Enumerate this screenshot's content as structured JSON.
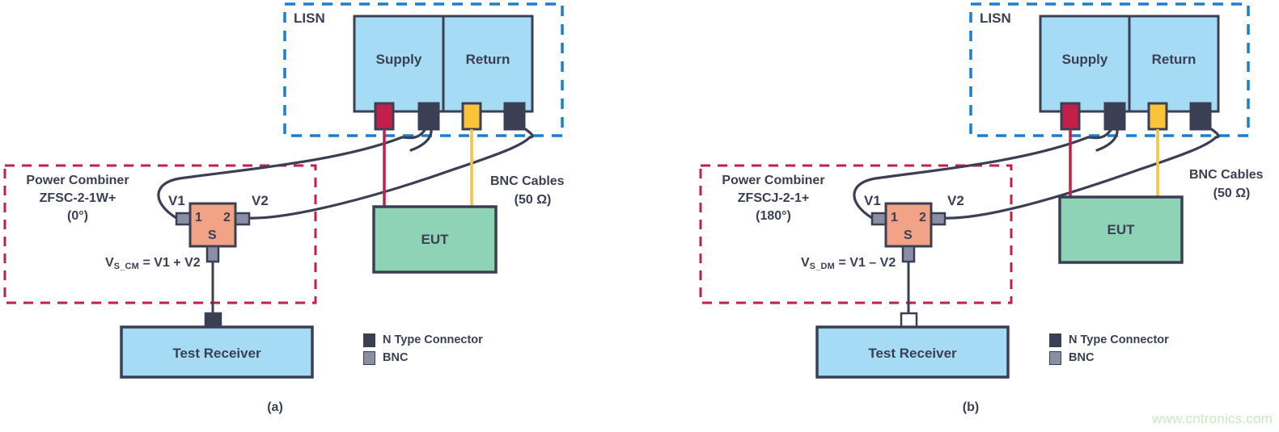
{
  "figure": {
    "watermark": "www.cntronics.com",
    "colors": {
      "stroke_dark": "#3b3f54",
      "box_blue": "#a5dbf5",
      "box_green": "#8ed3b6",
      "box_orange": "#f2a285",
      "dash_blue": "#1a7fd4",
      "dash_red": "#c2204a",
      "conn_red": "#c2204a",
      "conn_yellow": "#fac338",
      "conn_n": "#3b3f54",
      "conn_bnc": "#8a8fa3",
      "watermark_green": "#cfe6c4"
    }
  },
  "legend": {
    "items": [
      {
        "label": "N Type Connector",
        "swatch": "n-type"
      },
      {
        "label": "BNC",
        "swatch": "bnc"
      }
    ]
  },
  "panels": [
    {
      "id": "a",
      "caption": "(a)",
      "lisn": {
        "title": "LISN",
        "sections": [
          "Supply",
          "Return"
        ],
        "connectors": [
          "red",
          "n-type",
          "yellow",
          "n-type"
        ]
      },
      "combiner": {
        "group_title": "Power Combiner",
        "model": "ZFSC-2-1W+",
        "phase": "(0°)",
        "port_labels": [
          "V1",
          "V2"
        ],
        "port_numbers": [
          "1",
          "2"
        ],
        "sum_port": "S",
        "equation_prefix": "V",
        "equation_subscript": "S_CM",
        "equation_rest": " = V1 + V2"
      },
      "eut": {
        "label": "EUT"
      },
      "receiver": {
        "label": "Test Receiver",
        "connector": "n-type"
      },
      "cables": {
        "label_line1": "BNC Cables",
        "label_line2": "(50 Ω)"
      }
    },
    {
      "id": "b",
      "caption": "(b)",
      "lisn": {
        "title": "LISN",
        "sections": [
          "Supply",
          "Return"
        ],
        "connectors": [
          "red",
          "n-type",
          "yellow",
          "n-type"
        ]
      },
      "combiner": {
        "group_title": "Power Combiner",
        "model": "ZFSCJ-2-1+",
        "phase": "(180°)",
        "port_labels": [
          "V1",
          "V2"
        ],
        "port_numbers": [
          "1",
          "2"
        ],
        "sum_port": "S",
        "equation_prefix": "V",
        "equation_subscript": "S_DM",
        "equation_rest": " = V1 – V2"
      },
      "eut": {
        "label": "EUT"
      },
      "receiver": {
        "label": "Test Receiver",
        "connector": "hollow"
      },
      "cables": {
        "label_line1": "BNC Cables",
        "label_line2": "(50 Ω)"
      }
    }
  ]
}
